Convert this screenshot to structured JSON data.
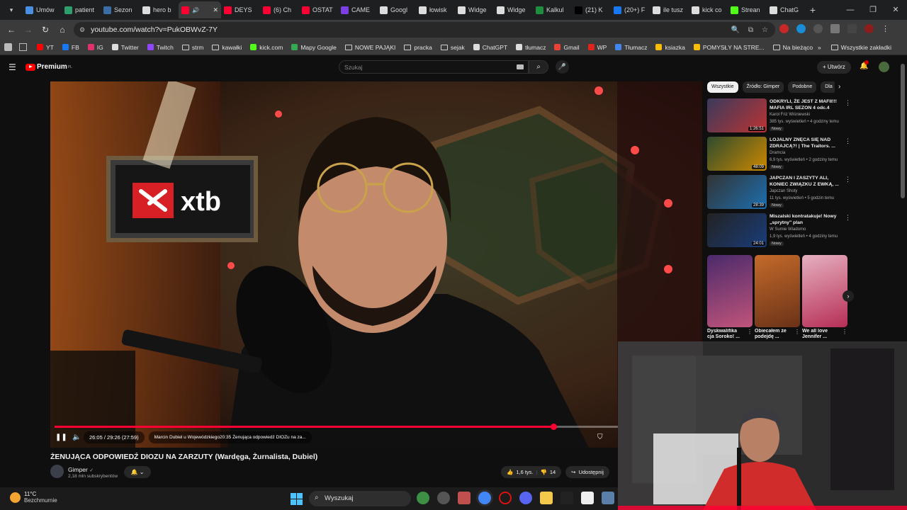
{
  "browser": {
    "tabs": [
      {
        "label": "Umów",
        "color": "#4a90e2"
      },
      {
        "label": "patient",
        "color": "#2e9e6b"
      },
      {
        "label": "Sezon",
        "color": "#3a6ea5"
      },
      {
        "label": "hero b",
        "color": "#dddddd"
      },
      {
        "label": "",
        "color": "#ff0033",
        "active": true
      },
      {
        "label": "DEYS",
        "color": "#ff0033"
      },
      {
        "label": "(6) Ch",
        "color": "#ff0033"
      },
      {
        "label": "OSTAT",
        "color": "#ff0033"
      },
      {
        "label": "CAME",
        "color": "#7b3fe4"
      },
      {
        "label": "Googl",
        "color": "#dddddd"
      },
      {
        "label": "łowisk",
        "color": "#dddddd"
      },
      {
        "label": "Widge",
        "color": "#dddddd"
      },
      {
        "label": "Widge",
        "color": "#dddddd"
      },
      {
        "label": "Kalkul",
        "color": "#1e8e3e"
      },
      {
        "label": "(21) K",
        "color": "#000000"
      },
      {
        "label": "(20+) F",
        "color": "#1877f2"
      },
      {
        "label": "ile tusz",
        "color": "#dddddd"
      },
      {
        "label": "kick co",
        "color": "#dddddd"
      },
      {
        "label": "Strean",
        "color": "#53fc18"
      },
      {
        "label": "ChatG",
        "color": "#dddddd"
      }
    ],
    "url": "youtube.com/watch?v=PukOBWvZ-7Y",
    "bookmarks": [
      {
        "label": "YT",
        "color": "#ff0000"
      },
      {
        "label": "FB",
        "color": "#1877f2"
      },
      {
        "label": "IG",
        "color": "#e1306c"
      },
      {
        "label": "Twitter",
        "color": "#dddddd"
      },
      {
        "label": "Twitch",
        "color": "#9146ff"
      },
      {
        "label": "strm",
        "folder": true
      },
      {
        "label": "kawałki",
        "folder": true
      },
      {
        "label": "kick.com",
        "color": "#53fc18"
      },
      {
        "label": "Mapy Google",
        "color": "#34a853"
      },
      {
        "label": "NOWE PAJĄKI",
        "folder": true
      },
      {
        "label": "pracka",
        "folder": true
      },
      {
        "label": "sejak",
        "folder": true
      },
      {
        "label": "ChatGPT",
        "color": "#dddddd"
      },
      {
        "label": "tłumacz",
        "color": "#dddddd"
      },
      {
        "label": "Gmail",
        "color": "#ea4335"
      },
      {
        "label": "WP",
        "color": "#e2231a"
      },
      {
        "label": "Tłumacz",
        "color": "#4285f4"
      },
      {
        "label": "ksiazka",
        "color": "#fbbc04"
      },
      {
        "label": "POMYSŁY NA STRE...",
        "color": "#fbbc04"
      },
      {
        "label": "Na bieżąco",
        "folder": true
      }
    ],
    "all_bookmarks": "Wszystkie zakładki"
  },
  "youtube": {
    "logo_text": "Premium",
    "region": "PL",
    "search_placeholder": "Szukaj",
    "create_label": "Utwórz",
    "video": {
      "time": "26:05 / 29:26 (27:59)",
      "chapter": "Marcin Dubiel u Wojewódzkiego20:35 Żenująca odpowiedź DIOZu na za...",
      "progress": 0.886,
      "title": "ŻENUJĄCA ODPOWIEDŹ DIOZU NA ZARZUTY (Wardęga, Żurnalista, Dubiel)",
      "channel": "Gimper",
      "subscribers": "2,18 mln subskrybentów",
      "likes": "1,6 tys.",
      "dislikes": "14",
      "share": "Udostępnij"
    },
    "chips": [
      {
        "label": "Wszystkie",
        "active": true
      },
      {
        "label": "Źródło: Gimper"
      },
      {
        "label": "Podobne"
      },
      {
        "label": "Dla"
      }
    ],
    "recommendations": [
      {
        "title": "ODKRYLI, ŻE JEST Z MAFII!!! MAFIA IRL SEZON 4 odc.4",
        "channel": "Karol Friz Wiśniewski",
        "meta": "385 tys. wyświetleń • 4 godziny temu",
        "duration": "1:26:51",
        "badge": "Nowy"
      },
      {
        "title": "LOJALNY ZNĘCA SIĘ NAD ZDRAJCĄ?! | The Traitors. ...",
        "channel": "Dramcia",
        "meta": "6,9 tys. wyświetleń • 2 godziny temu",
        "duration": "48:09",
        "badge": "Nowy"
      },
      {
        "title": "JAPCZAN I ZASZYTY ALI, KONIEC ZWIĄZKU Z EWKĄ, ...",
        "channel": "Japczan Shoty",
        "meta": "11 tys. wyświetleń • 5 godzin temu",
        "duration": "28:39",
        "badge": "Nowy"
      },
      {
        "title": "Miszalski kontratakuje! Nowy „sprytny\" plan",
        "channel": "W Sumie Wiadomo",
        "meta": "1,9 tys. wyświetleń • 4 godziny temu",
        "duration": "24:01",
        "badge": "Nowy"
      }
    ],
    "shorts": [
      {
        "title": "Dyskwalifika cja Soroko! ..."
      },
      {
        "title": "Obiecałem że podejdę ..."
      },
      {
        "title": "We all love Jennifer ..."
      }
    ]
  },
  "taskbar": {
    "temperature": "11°C",
    "condition": "Bezchmurnie",
    "search": "Wyszukaj"
  },
  "colors": {
    "accent": "#ff0033",
    "background": "#0f0f0f"
  }
}
